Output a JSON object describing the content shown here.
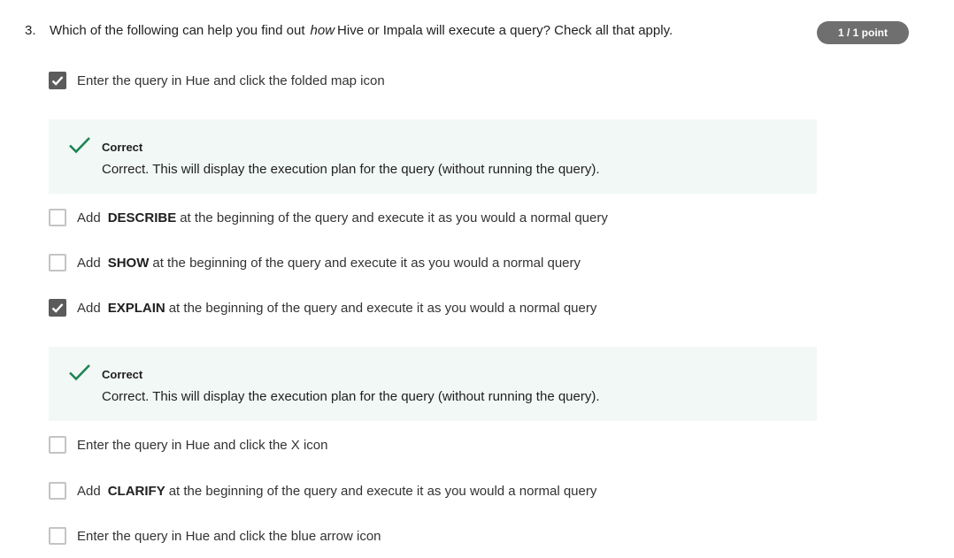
{
  "question": {
    "number": "3.",
    "text_before": "Which of the following can help you find out",
    "text_emphasis": "how",
    "text_after": "Hive or Impala will execute a query? Check all that apply.",
    "score_badge": "1 / 1 point"
  },
  "options": [
    {
      "checked": true,
      "prefix": "",
      "keyword": "",
      "text": "Enter the query in Hue and click the folded map icon"
    },
    {
      "checked": false,
      "prefix": "Add",
      "keyword": "DESCRIBE",
      "text": "at the beginning of the query and execute it as you would a normal query"
    },
    {
      "checked": false,
      "prefix": "Add",
      "keyword": "SHOW",
      "text": "at the beginning of the query and execute it as you would a normal query"
    },
    {
      "checked": true,
      "prefix": "Add",
      "keyword": "EXPLAIN",
      "text": "at the beginning of the query and execute it as you would a normal query"
    },
    {
      "checked": false,
      "prefix": "",
      "keyword": "",
      "text": "Enter the query in Hue and click the X icon"
    },
    {
      "checked": false,
      "prefix": "Add",
      "keyword": "CLARIFY",
      "text": "at the beginning of the query and execute it as you would a normal query"
    },
    {
      "checked": false,
      "prefix": "",
      "keyword": "",
      "text": "Enter the query in Hue and click the blue arrow icon"
    }
  ],
  "feedback": [
    {
      "title": "Correct",
      "body": "Correct. This will display the execution plan for the query (without running the query)."
    },
    {
      "title": "Correct",
      "body": "Correct. This will display the execution plan for the query (without running the query)."
    }
  ],
  "colors": {
    "correct_green": "#1f8354",
    "feedback_bg": "#f2f8f6",
    "checkbox_checked": "#5b5b5b",
    "badge_bg": "#6f6f6f"
  },
  "icons": {
    "checkbox_mark": "check-icon",
    "feedback_mark": "check-icon"
  }
}
